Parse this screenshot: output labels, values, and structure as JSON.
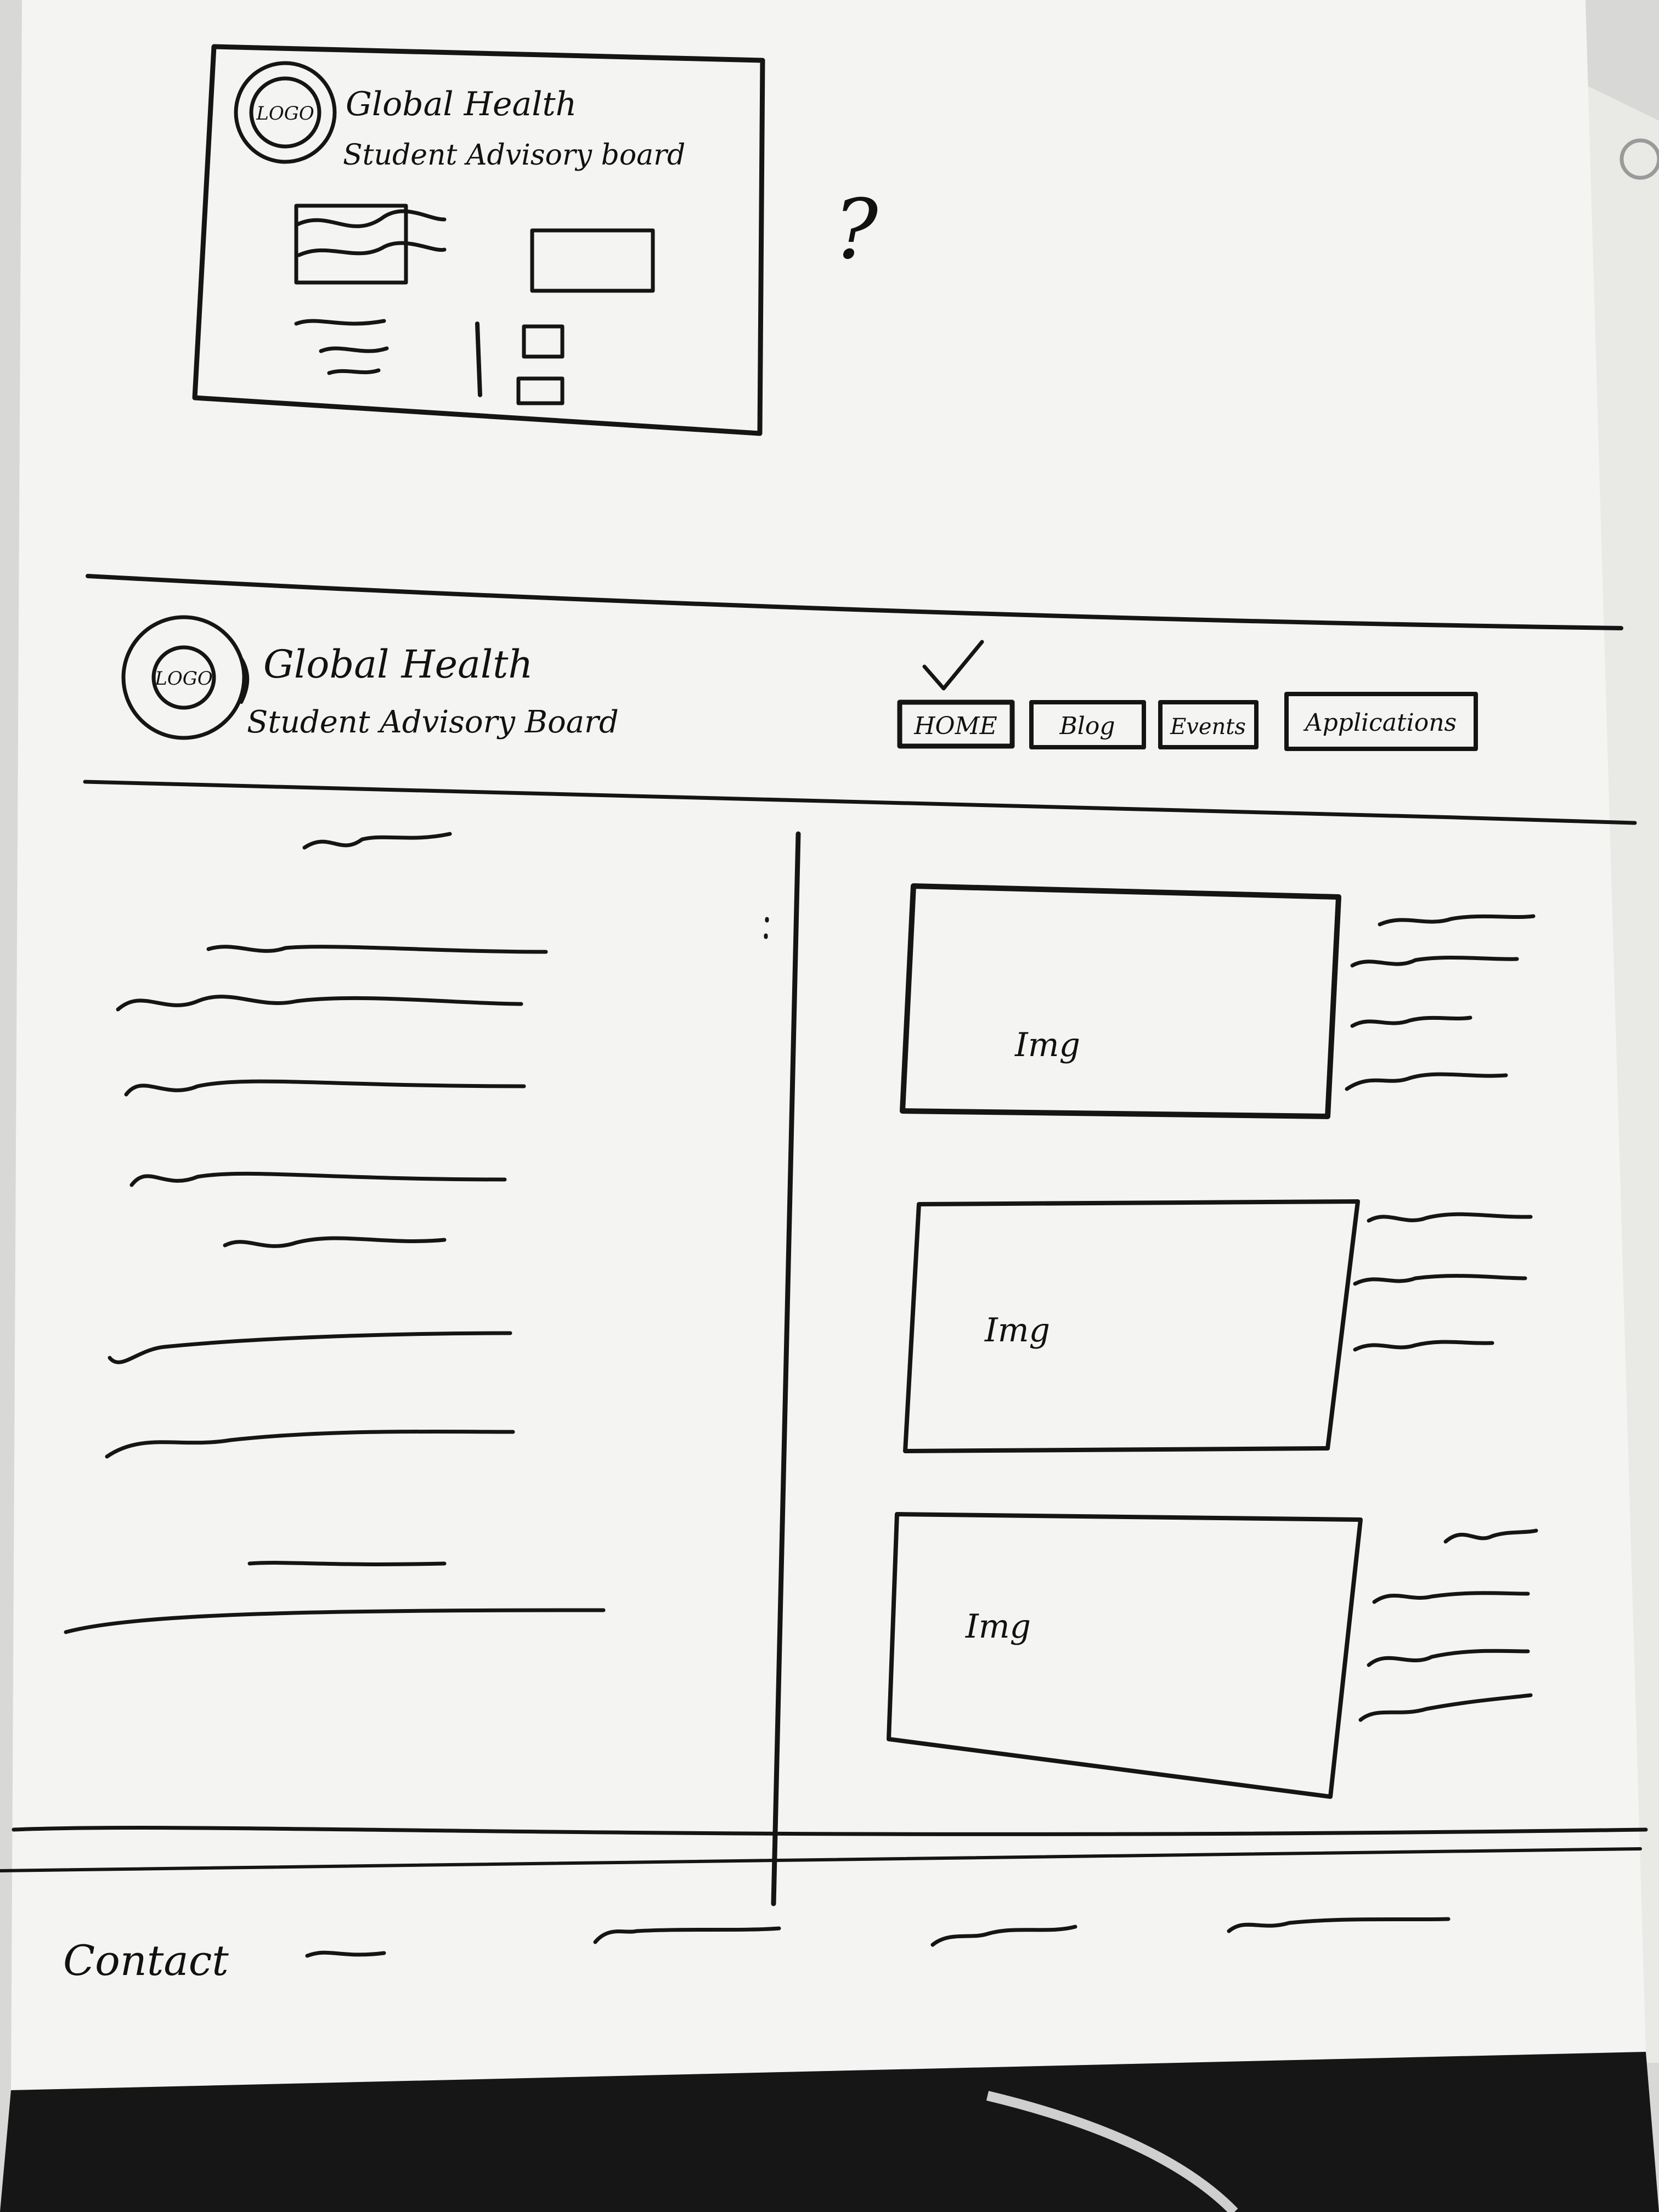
{
  "sketch_top": {
    "logo_label": "LOGO",
    "title_line1": "Global Health",
    "title_line2": "Student Advisory board",
    "question_mark": "?"
  },
  "sketch_main": {
    "logo_label": "LOGO",
    "title_line1": "Global Health",
    "title_line2": "Student Advisory Board",
    "selected_check": "✓",
    "nav": [
      {
        "label": "HOME"
      },
      {
        "label": "Blog"
      },
      {
        "label": "Events"
      },
      {
        "label": "Applications"
      }
    ],
    "images": [
      {
        "label": "Img"
      },
      {
        "label": "Img"
      },
      {
        "label": "Img"
      }
    ],
    "footer_label": "Contact"
  },
  "colors": {
    "paper": "#f4f4f2",
    "ink": "#151515",
    "background": "#3a3a3a"
  }
}
